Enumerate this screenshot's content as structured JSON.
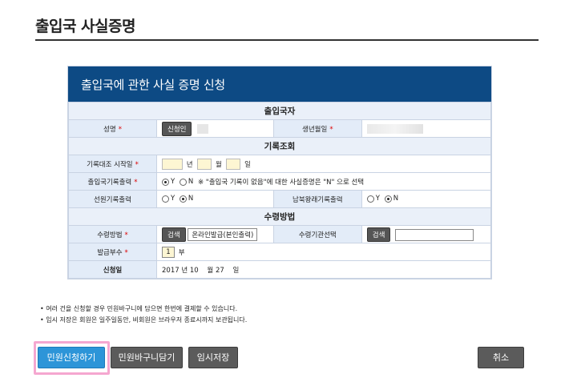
{
  "page": {
    "title": "출입국 사실증명"
  },
  "form": {
    "heading": "출입국에 관한 사실 증명 신청",
    "sections": {
      "applicant": "출입국자",
      "record": "기록조회",
      "receive": "수령방법"
    },
    "name_label": "성명",
    "applicant_button": "신청인",
    "birth_label": "생년월일",
    "required_mark": "*",
    "start_date_label": "기록대조 시작일",
    "year_unit": "년",
    "month_unit": "월",
    "day_unit": "일",
    "output_label": "출입국기록출력",
    "output_note": "※ \"출입국 기록이 없음\"에 대한 사실증명은 \"N\" 으로 선택",
    "yes": "Y",
    "no": "N",
    "crew_label": "선원기록출력",
    "nk_label": "남북왕래기록출력",
    "receive_method_label": "수령방법",
    "search_button": "검색",
    "receive_method_value": "온라인발급(본인출력)",
    "receive_org_label": "수령기관선택",
    "copies_label": "발급부수",
    "copies_value": "1",
    "copies_unit": "부",
    "apply_date_label": "신청일",
    "apply_date": {
      "year": "2017",
      "year_unit": "년",
      "month": "10",
      "month_unit": "월",
      "day": "27",
      "day_unit": "일"
    }
  },
  "notes": [
    "• 여러 건을 신청할 경우 민원바구니에 담으면 한번에 결제할 수 있습니다.",
    "• 임시 저장은 회원은 일주일동안, 비회원은 브라우저 종료시까지 보관됩니다."
  ],
  "buttons": {
    "apply": "민원신청하기",
    "basket": "민원바구니담기",
    "temp_save": "임시저장",
    "cancel": "취소"
  }
}
